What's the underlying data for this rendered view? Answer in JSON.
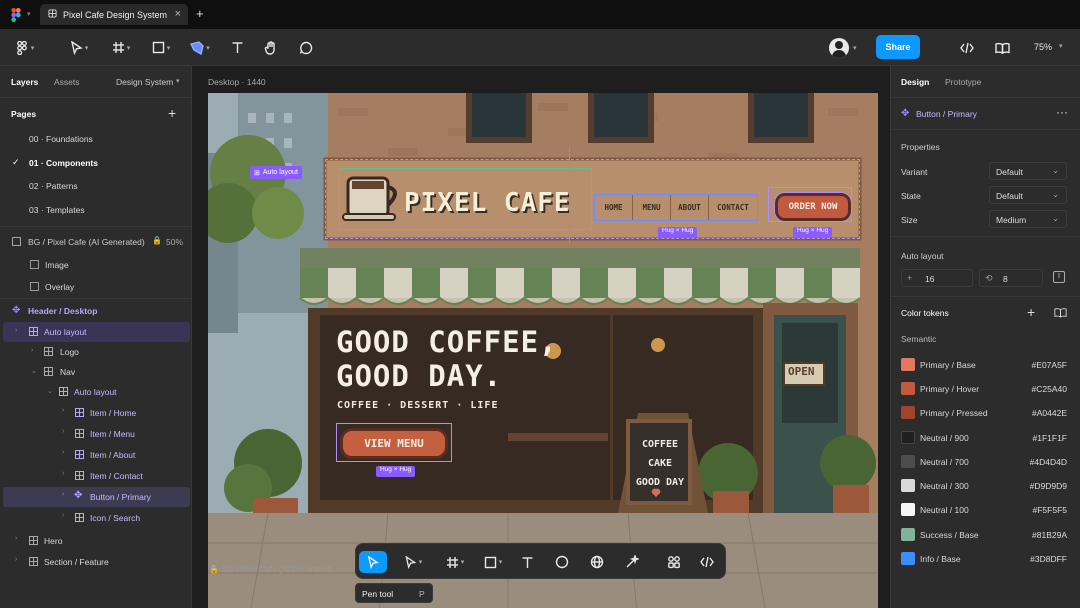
{
  "titlebar": {
    "tab_title": "Pixel Cafe Design System"
  },
  "toolbar": {
    "share_label": "Share",
    "zoom": "75%"
  },
  "left_panel": {
    "tabs": [
      "Layers",
      "Assets"
    ],
    "design_system_label": "Design System",
    "pages_heading": "Pages",
    "pages": [
      "00 · Foundations",
      "01 · Components",
      "02 · Patterns",
      "03 · Templates"
    ],
    "bg_layer": {
      "label": "BG / Pixel Cafe (AI Generated)",
      "opacity": "50%"
    },
    "bg_children": [
      "Image",
      "Overlay"
    ],
    "header_layer": "Header / Desktop",
    "layers": [
      {
        "label": "Auto layout"
      },
      {
        "label": "Logo"
      },
      {
        "label": "Nav"
      },
      {
        "label": "Auto layout"
      },
      {
        "label": "Item / Home"
      },
      {
        "label": "Item / Menu"
      },
      {
        "label": "Item / About"
      },
      {
        "label": "Item / Contact"
      },
      {
        "label": "Button / Primary"
      },
      {
        "label": "Icon / Search"
      }
    ],
    "bottom_layers": [
      "Hero",
      "Section / Feature"
    ]
  },
  "canvas": {
    "frame_label": "Desktop · 1440",
    "bottom_label": "BG / Pixel Cafe (AI Generated)",
    "auto_layout_tag": "Auto layout",
    "hug_tags": [
      "Hug × Hug",
      "Hug × Hug",
      "Hug × Hug"
    ],
    "scene": {
      "logo_text": "PIXEL CAFE",
      "nav": [
        "HOME",
        "MENU",
        "ABOUT",
        "CONTACT"
      ],
      "order_button": "ORDER NOW",
      "headline_1": "GOOD COFFEE,",
      "headline_2": "GOOD DAY.",
      "subline": "COFFEE · DESSERT · LIFE",
      "cta": "VIEW MENU",
      "open_sign": "OPEN",
      "chalkboard": [
        "COFFEE",
        "CAKE",
        "GOOD DAY"
      ]
    }
  },
  "bottom_toolbar": {
    "tooltip_label": "Pen tool",
    "tooltip_shortcut": "P"
  },
  "right_panel": {
    "tabs": [
      "Design",
      "Prototype"
    ],
    "component_name": "Button / Primary",
    "properties_heading": "Properties",
    "properties": [
      {
        "label": "Variant",
        "value": "Default"
      },
      {
        "label": "State",
        "value": "Default"
      },
      {
        "label": "Size",
        "value": "Medium"
      }
    ],
    "auto_layout_heading": "Auto layout",
    "gap": "16",
    "padding": "8",
    "color_tokens_heading": "Color tokens",
    "semantic_label": "Semantic",
    "tokens": [
      {
        "name": "Primary / Base",
        "hex": "#E07A5F",
        "color": "#E07A5F"
      },
      {
        "name": "Primary / Hover",
        "hex": "#C25A40",
        "color": "#C25A40"
      },
      {
        "name": "Primary / Pressed",
        "hex": "#A0442E",
        "color": "#A0442E"
      },
      {
        "name": "Neutral / 900",
        "hex": "#1F1F1F",
        "color": "#1F1F1F"
      },
      {
        "name": "Neutral / 700",
        "hex": "#4D4D4D",
        "color": "#4D4D4D"
      },
      {
        "name": "Neutral / 300",
        "hex": "#D9D9D9",
        "color": "#D9D9D9"
      },
      {
        "name": "Neutral / 100",
        "hex": "#F5F5F5",
        "color": "#F5F5F5"
      },
      {
        "name": "Success / Base",
        "hex": "#81B29A",
        "color": "#81B29A"
      },
      {
        "name": "Info / Base",
        "hex": "#3D8DFF",
        "color": "#3D8DFF"
      }
    ]
  },
  "colors": {
    "accent": "#0d99ff",
    "selection": "#9747ff"
  }
}
